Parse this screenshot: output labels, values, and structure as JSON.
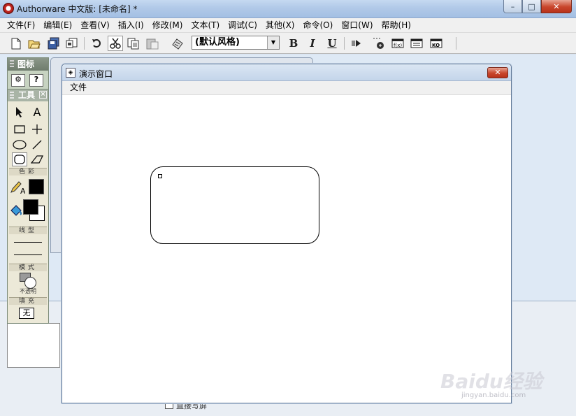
{
  "window": {
    "title": "Authorware 中文版: [未命名] *",
    "minimize": "–",
    "maximize": "□",
    "close": "✕"
  },
  "menubar": {
    "items": [
      {
        "label": "文件(F)"
      },
      {
        "label": "编辑(E)"
      },
      {
        "label": "查看(V)"
      },
      {
        "label": "插入(I)"
      },
      {
        "label": "修改(M)"
      },
      {
        "label": "文本(T)"
      },
      {
        "label": "调试(C)"
      },
      {
        "label": "其他(X)"
      },
      {
        "label": "命令(O)"
      },
      {
        "label": "窗口(W)"
      },
      {
        "label": "帮助(H)"
      }
    ]
  },
  "toolbar": {
    "style_select": "(默认风格)",
    "bold": "B",
    "italic": "I",
    "underline": "U",
    "icons": [
      "new-file-icon",
      "open-file-icon",
      "save-all-icon",
      "import-icon",
      "undo-icon",
      "cut-icon",
      "copy-icon",
      "paste-icon",
      "find-icon",
      "bold-icon",
      "italic-icon",
      "underline-icon",
      "run-icon",
      "control-panel-icon",
      "functions-icon",
      "variables-icon",
      "knowledge-objects-icon"
    ]
  },
  "icons_palette": {
    "title": "图标"
  },
  "tools_palette": {
    "title": "工具",
    "sections": {
      "color": "色彩",
      "line": "线型",
      "mode": "模式",
      "fill": "填充"
    },
    "mode_value": "不透明",
    "fill_value": "无",
    "colors": {
      "line_color": "#000000",
      "fill_foreground": "#000000",
      "fill_background": "#ffffff"
    }
  },
  "presentation_window": {
    "title": "演示窗口",
    "menu": [
      "文件"
    ],
    "close": "✕"
  },
  "background": {
    "checkbox_label": "直接写屏"
  },
  "watermark": {
    "main": "Baidu经验",
    "sub": "jingyan.baidu.com"
  }
}
